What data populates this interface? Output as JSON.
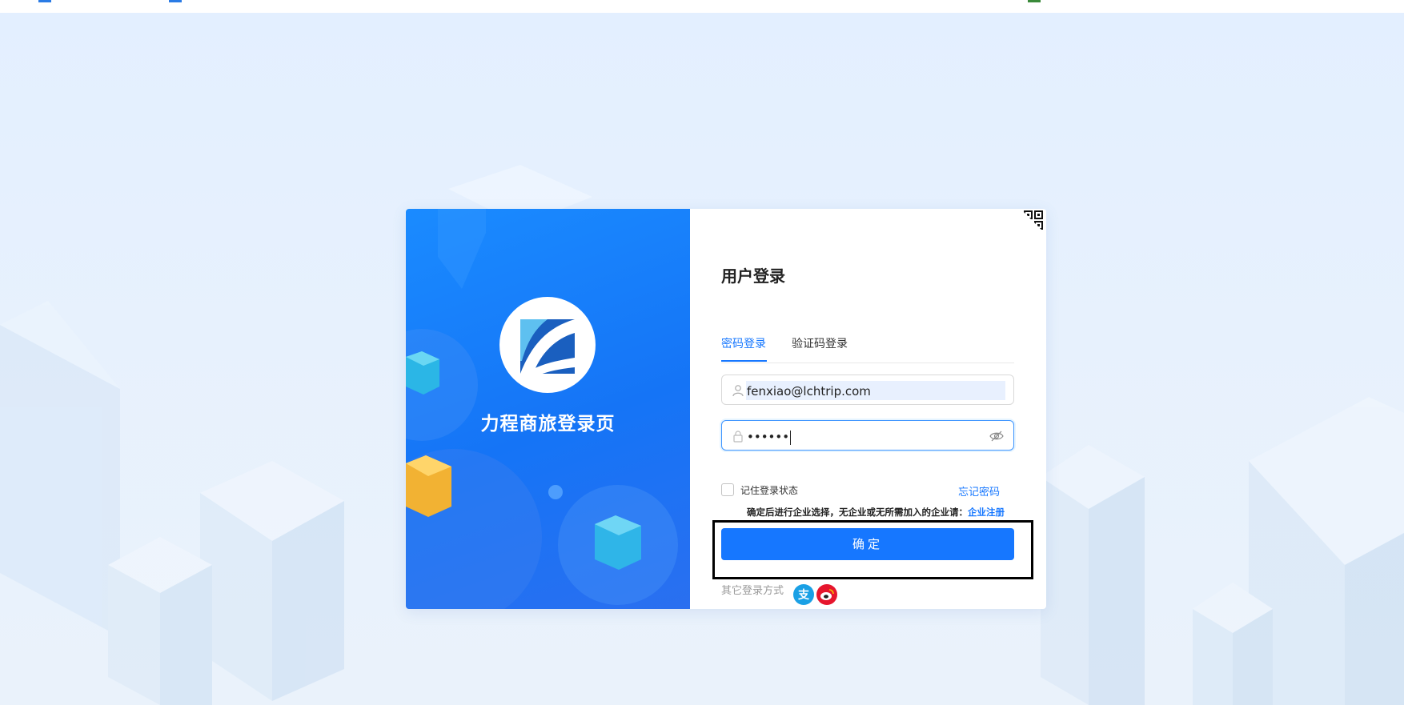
{
  "page": {
    "brand_name": "力程商旅登录页"
  },
  "login": {
    "title": "用户登录",
    "tabs": [
      {
        "label": "密码登录",
        "active": true
      },
      {
        "label": "验证码登录",
        "active": false
      }
    ],
    "username": {
      "value": "fenxiao@lchtrip.com",
      "icon": "user-icon"
    },
    "password": {
      "value": "••••••",
      "icon": "lock-icon",
      "toggle_icon": "eye-hidden-icon"
    },
    "remember_label": "记住登录状态",
    "remember_checked": false,
    "forgot_label": "忘记密码",
    "notice_text": "确定后进行企业选择，无企业或无所需加入的企业请：",
    "notice_link": "企业注册",
    "submit_label": "确定",
    "other_methods_label": "其它登录方式",
    "social": [
      {
        "icon": "alipay-icon",
        "color": "#1aa0e5"
      },
      {
        "icon": "weibo-icon",
        "color": "#e6162d"
      }
    ],
    "qr_icon": "qr-code-icon"
  },
  "colors": {
    "primary": "#1677ff",
    "panel": "#1574f6",
    "background": "#e3efff"
  }
}
